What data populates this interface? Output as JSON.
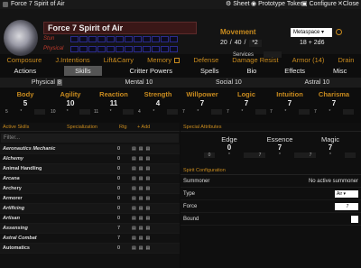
{
  "window": {
    "title": "Force 7 Spirit of Air",
    "sheet": "Sheet",
    "prototype": "Prototype Token",
    "configure": "Configure",
    "close": "Close"
  },
  "header": {
    "name": "Force 7 Spirit of Air",
    "stun": "Stun",
    "physical": "Physical",
    "movement": "Movement",
    "move_walk": "20",
    "move_run": "40",
    "move_mod": "*2",
    "metaspace": "Metaspace",
    "initiative": "18",
    "initiative_dice": "+ 2d6",
    "services": "Services",
    "services_value": "0"
  },
  "nav": [
    "Composure",
    "J.Intentions",
    "Lift&Carry",
    "Memory",
    "Defense",
    "Damage Resist",
    "Armor (14)",
    "Drain"
  ],
  "tabs": [
    "Actions",
    "Skills",
    "Critter Powers",
    "Spells",
    "Bio",
    "Effects",
    "Misc"
  ],
  "bands": {
    "physical_label": "Physical",
    "physical": "8",
    "mental_label": "Mental",
    "mental": "10",
    "social_label": "Social",
    "social": "10",
    "astral_label": "Astral",
    "astral": "10"
  },
  "attributes": [
    {
      "name": "Body",
      "value": "5",
      "a": "5",
      "b": "*"
    },
    {
      "name": "Agility",
      "value": "10",
      "a": "10",
      "b": "*"
    },
    {
      "name": "Reaction",
      "value": "11",
      "a": "11",
      "b": "*"
    },
    {
      "name": "Strength",
      "value": "4",
      "a": "4",
      "b": "*"
    },
    {
      "name": "Willpower",
      "value": "7",
      "a": "7",
      "b": "*"
    },
    {
      "name": "Logic",
      "value": "7",
      "a": "7",
      "b": "*"
    },
    {
      "name": "Intuition",
      "value": "7",
      "a": "7",
      "b": "*"
    },
    {
      "name": "Charisma",
      "value": "7",
      "a": "7",
      "b": "*"
    }
  ],
  "skills_header": {
    "title": "Active Skills",
    "spec": "Specialization",
    "rtg": "Rtg",
    "add": "+ Add"
  },
  "filter_placeholder": "Filter...",
  "skills": [
    {
      "name": "Aeronautics Mechanic",
      "rtg": "0",
      "it": true
    },
    {
      "name": "Alchemy",
      "rtg": "0",
      "it": true
    },
    {
      "name": "Animal Handling",
      "rtg": "0",
      "it": false
    },
    {
      "name": "Arcana",
      "rtg": "0",
      "it": true
    },
    {
      "name": "Archery",
      "rtg": "0",
      "it": false
    },
    {
      "name": "Armorer",
      "rtg": "0",
      "it": false
    },
    {
      "name": "Artificing",
      "rtg": "0",
      "it": true
    },
    {
      "name": "Artisan",
      "rtg": "0",
      "it": true
    },
    {
      "name": "Assensing",
      "rtg": "7",
      "it": true
    },
    {
      "name": "Astral Combat",
      "rtg": "7",
      "it": true
    },
    {
      "name": "Automatics",
      "rtg": "0",
      "it": false
    }
  ],
  "special": {
    "title": "Special Attributes",
    "edge": "Edge",
    "edge_v": "0",
    "edge_a": "0",
    "essence": "Essence",
    "essence_v": "7",
    "essence_a": "7",
    "magic": "Magic",
    "magic_v": "7",
    "magic_a": "7",
    "star": "*"
  },
  "spirit": {
    "title": "Spirit Configuration",
    "summoner": "Summoner",
    "summoner_v": "No active summoner",
    "type": "Type",
    "type_v": "Air",
    "force": "Force",
    "force_v": "7",
    "bound": "Bound"
  }
}
